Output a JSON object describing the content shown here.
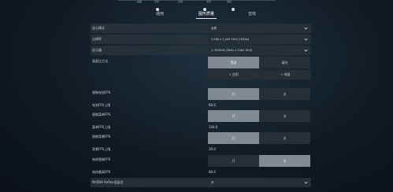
{
  "top_nav": {
    "sub_labels": [
      "画面",
      "音效",
      "控制",
      "游戏",
      "网络"
    ],
    "tabs": [
      {
        "label": "通用",
        "active": false
      },
      {
        "label": "图形质量",
        "active": true
      },
      {
        "label": "音效",
        "active": false
      }
    ]
  },
  "settings": {
    "display_mode": {
      "label": "显示模式",
      "value": "全屏"
    },
    "resolution": {
      "label": "分辨率",
      "value": "2,560 x 1,440 16:9 (165Hz)"
    },
    "monitor": {
      "label": "显示器",
      "value": "1. M35CM (3840 x 2160 16:9)"
    },
    "aspect_method": {
      "label": "画面比方法",
      "options": [
        "黑屏",
        "填充"
      ],
      "selected": 0
    },
    "buttons": {
      "apply": "应用",
      "restore": "恢复"
    },
    "limit_battery_fps": {
      "label": "限制电池FPS",
      "options": [
        "开",
        "关"
      ],
      "selected": 0
    },
    "battery_fps_cap": {
      "label": "电池FPS上限",
      "value": "60.0"
    },
    "limit_menu_fps": {
      "label": "限制菜单FPS",
      "options": [
        "开",
        "关"
      ],
      "selected": 0
    },
    "menu_fps_cap": {
      "label": "菜单FPS上限",
      "value": "144.0"
    },
    "limit_background_fps": {
      "label": "限制背景FPS",
      "options": [
        "开",
        "关"
      ],
      "selected": 0
    },
    "background_fps_cap": {
      "label": "背景FPS上限",
      "value": "30.0"
    },
    "limit_max_fps": {
      "label": "始终限制FPS",
      "options": [
        "开",
        "关"
      ],
      "selected": 1
    },
    "max_fps_cap": {
      "label": "始终最高FPS",
      "value": "60.0"
    },
    "nvidia_reflex": {
      "label": "NVIDIA Reflex低延迟",
      "value": "开"
    }
  }
}
